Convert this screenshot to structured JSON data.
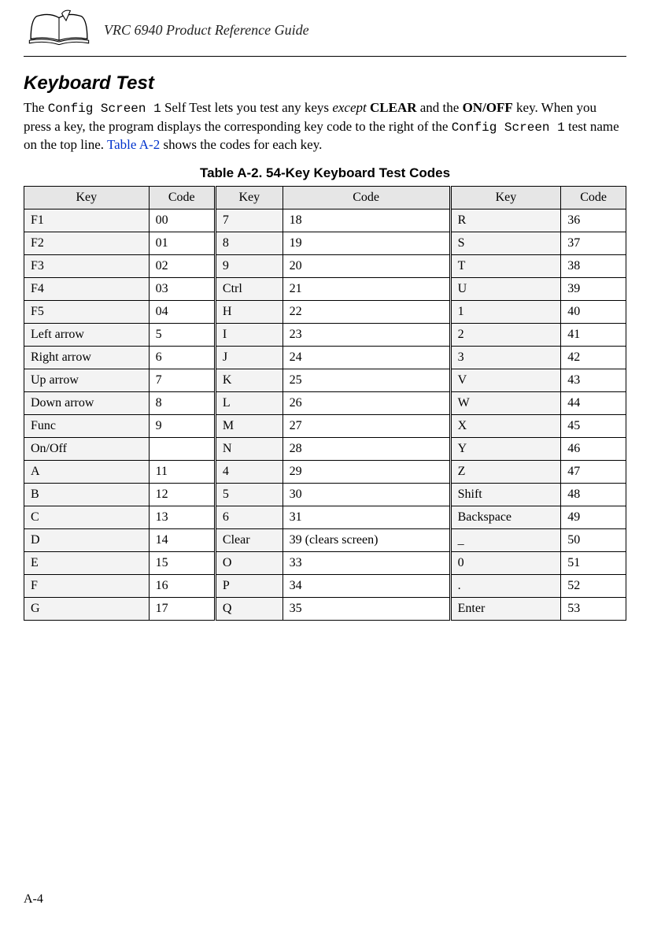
{
  "header": {
    "doc_title": "VRC 6940 Product Reference Guide"
  },
  "section": {
    "heading": "Keyboard Test",
    "para_pre1": "The ",
    "para_mono1": "Config Screen 1",
    "para_mid1": " Self Test lets you test any keys ",
    "para_italic": "except",
    "para_mid2": " ",
    "para_bold1": "CLEAR",
    "para_mid3": " and the ",
    "para_bold2": "ON/OFF",
    "para_mid4": " key. When you press a key, the program displays the corresponding key code to the right of the ",
    "para_mono2": "Config Screen 1",
    "para_mid5": " test name on the top line. ",
    "para_link": "Table A-2",
    "para_end": " shows the codes for each key."
  },
  "table": {
    "caption": "Table A-2. 54-Key Keyboard Test Codes",
    "head": {
      "key": "Key",
      "code": "Code"
    },
    "rows": [
      {
        "k1": "F1",
        "c1": "00",
        "k2": "7",
        "c2": "18",
        "k3": "R",
        "c3": "36"
      },
      {
        "k1": "F2",
        "c1": "01",
        "k2": "8",
        "c2": "19",
        "k3": "S",
        "c3": "37"
      },
      {
        "k1": "F3",
        "c1": "02",
        "k2": "9",
        "c2": "20",
        "k3": "T",
        "c3": "38"
      },
      {
        "k1": "F4",
        "c1": "03",
        "k2": "Ctrl",
        "c2": "21",
        "k3": "U",
        "c3": "39"
      },
      {
        "k1": "F5",
        "c1": "04",
        "k2": "H",
        "c2": "22",
        "k3": "1",
        "c3": "40"
      },
      {
        "k1": "Left arrow",
        "c1": "5",
        "k2": "I",
        "c2": "23",
        "k3": "2",
        "c3": "41"
      },
      {
        "k1": "Right arrow",
        "c1": "6",
        "k2": "J",
        "c2": "24",
        "k3": "3",
        "c3": "42"
      },
      {
        "k1": "Up arrow",
        "c1": "7",
        "k2": "K",
        "c2": "25",
        "k3": "V",
        "c3": "43"
      },
      {
        "k1": "Down arrow",
        "c1": "8",
        "k2": "L",
        "c2": "26",
        "k3": "W",
        "c3": "44"
      },
      {
        "k1": "Func",
        "c1": "9",
        "k2": "M",
        "c2": "27",
        "k3": "X",
        "c3": "45"
      },
      {
        "k1": "On/Off",
        "c1": "",
        "k2": "N",
        "c2": "28",
        "k3": "Y",
        "c3": "46"
      },
      {
        "k1": "A",
        "c1": "11",
        "k2": "4",
        "c2": "29",
        "k3": "Z",
        "c3": "47"
      },
      {
        "k1": "B",
        "c1": "12",
        "k2": "5",
        "c2": "30",
        "k3": "Shift",
        "c3": "48"
      },
      {
        "k1": "C",
        "c1": "13",
        "k2": "6",
        "c2": "31",
        "k3": "Backspace",
        "c3": "49"
      },
      {
        "k1": "D",
        "c1": "14",
        "k2": "Clear",
        "c2": "39 (clears screen)",
        "k3": "_",
        "c3": "50"
      },
      {
        "k1": "E",
        "c1": "15",
        "k2": "O",
        "c2": "33",
        "k3": "0",
        "c3": "51"
      },
      {
        "k1": "F",
        "c1": "16",
        "k2": "P",
        "c2": "34",
        "k3": ".",
        "c3": "52"
      },
      {
        "k1": "G",
        "c1": "17",
        "k2": "Q",
        "c2": "35",
        "k3": "Enter",
        "c3": "53"
      }
    ]
  },
  "footer": {
    "page_number": "A-4"
  }
}
